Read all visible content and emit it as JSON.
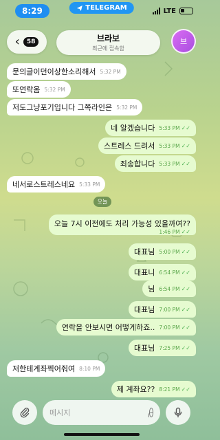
{
  "status_bar": {
    "time": "8:29",
    "app_label": "TELEGRAM",
    "network": "LTE"
  },
  "header": {
    "back_count": "58",
    "chat_name": "브라보",
    "chat_status": "최근에 접속함",
    "avatar_initial": "브"
  },
  "date_chip": "오늘",
  "messages": [
    {
      "dir": "in",
      "text": "문의글이던이상한소리해서",
      "time": "5:32 PM"
    },
    {
      "dir": "in",
      "text": "또연락옴",
      "time": "5:32 PM"
    },
    {
      "dir": "in",
      "text": "저도그냥포기입니다 그쪽라인은",
      "time": "5:32 PM"
    },
    {
      "dir": "out",
      "text": "네 알겠습니다",
      "time": "5:33 PM"
    },
    {
      "dir": "out",
      "text": "스트레스 드려서",
      "time": "5:33 PM"
    },
    {
      "dir": "out",
      "text": "죄송합니다",
      "time": "5:33 PM"
    },
    {
      "dir": "in",
      "text": "네서로스트레스네요",
      "time": "5:33 PM"
    },
    {
      "dir": "out",
      "text": "오늘 7시 이전에도 처리 가능성 있을까여??",
      "time": "1:46 PM"
    },
    {
      "dir": "out",
      "text": "대표님",
      "time": "5:00 PM"
    },
    {
      "dir": "out",
      "text": "대표니",
      "time": "6:54 PM"
    },
    {
      "dir": "out",
      "text": "님",
      "time": "6:54 PM"
    },
    {
      "dir": "out",
      "text": "대표님",
      "time": "7:00 PM"
    },
    {
      "dir": "out",
      "text": "연락을 안보시면 어떻게하죠..",
      "time": "7:00 PM"
    },
    {
      "dir": "out",
      "text": "대표님",
      "time": "7:25 PM"
    },
    {
      "dir": "in",
      "text": "저한테계좌찍어줘여",
      "time": "8:10 PM"
    },
    {
      "dir": "out",
      "text": "제 계좌요??",
      "time": "8:21 PM"
    }
  ],
  "input": {
    "placeholder": "메시지"
  },
  "icons": {
    "attach": "paperclip-icon",
    "sticker": "sticker-icon",
    "mic": "microphone-icon",
    "read": "double-check-icon"
  },
  "colors": {
    "incoming_bubble": "#ffffff",
    "outgoing_bubble": "#e6fbd0",
    "accent": "#2196f3",
    "read_check": "#4caf50"
  }
}
